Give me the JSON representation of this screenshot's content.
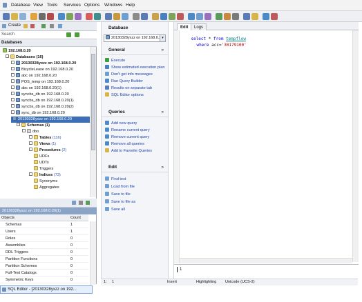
{
  "menu": [
    "Database",
    "View",
    "Tools",
    "Services",
    "Options",
    "Windows",
    "Help"
  ],
  "left": {
    "new_button_label": "Create",
    "search_label": "Search",
    "databases_header": "Databases",
    "server_name": "192.168.0.20",
    "databases_node": "Databases (16)",
    "databases_tree": [
      {
        "label": "20130328yxzz on 192.168.0.20",
        "bold": true
      },
      {
        "label": "BicycleLease on 192.168.0.20"
      },
      {
        "label": "abc on 192.168.0.20"
      },
      {
        "label": "POS_temp on 192.168.0.20"
      },
      {
        "label": "abc on 192.168.0.20(1)"
      },
      {
        "label": "syncbs_db on 192.168.0.20"
      },
      {
        "label": "syncbs_db on 192.168.0.20(1)"
      },
      {
        "label": "syncbs_db on 192.168.0.20(2)"
      },
      {
        "label": "sync_db on 192.168.0.20"
      }
    ],
    "selected_db": "20130328yxzz on 192.168.0.20",
    "schemas_node": "Schemas (1)",
    "dbo_node": "dbo",
    "schema_children": [
      {
        "label": "Tables",
        "count": "(116)"
      },
      {
        "label": "Views",
        "count": "(1)"
      },
      {
        "label": "Procedures",
        "count": "(2)"
      },
      {
        "label": "UDFs",
        "count": ""
      },
      {
        "label": "UDTs",
        "count": ""
      },
      {
        "label": "Triggers",
        "count": ""
      },
      {
        "label": "Indices",
        "count": "(73)"
      },
      {
        "label": "Synonyms",
        "count": ""
      },
      {
        "label": "Aggregates",
        "count": ""
      }
    ],
    "objects_header_title": "20130328yxzz on 192.168.0.20(1)",
    "objects_col_name": "Objects",
    "objects_col_count": "Count",
    "objects": [
      {
        "name": "Schemas",
        "count": "1"
      },
      {
        "name": "Users",
        "count": "1"
      },
      {
        "name": "Roles",
        "count": "0"
      },
      {
        "name": "Assemblies",
        "count": "0"
      },
      {
        "name": "DDL Triggers",
        "count": "0"
      },
      {
        "name": "Partition Functions",
        "count": "0"
      },
      {
        "name": "Partition Schemes",
        "count": "0"
      },
      {
        "name": "Full-Text Catalogs",
        "count": "0"
      },
      {
        "name": "Symmetric Keys",
        "count": "0"
      }
    ]
  },
  "middle": {
    "database_label": "Database",
    "database_value": "20130328yxzz on 192.168.0.20",
    "sections": {
      "general": {
        "title": "General",
        "items": [
          "Execute",
          "Show estimated execution plan",
          "Don't get info messages",
          "Run Query Builder",
          "Results on separate tab",
          "SQL Editor options"
        ]
      },
      "queries": {
        "title": "Queries",
        "items": [
          "Add new query",
          "Rename current query",
          "Remove current query",
          "Remove all queries",
          "Add to Favorite Queries"
        ]
      },
      "edit": {
        "title": "Edit",
        "items": [
          "Find text",
          "Load from file",
          "Save to file",
          "Save to file as",
          "Save all"
        ]
      }
    }
  },
  "editor": {
    "tabs": [
      "Edit",
      "Logs"
    ],
    "line1": {
      "kw1": "select",
      "mid": " * ",
      "kw2": "from",
      "table": "tempflow"
    },
    "line2": {
      "kw": "where",
      "text": " acc=",
      "str": "'30179100'"
    },
    "result_line": "1"
  },
  "status": {
    "pos1": "1:",
    "pos2": "1",
    "mode": "Insert",
    "highlighting": "Highlighting",
    "encoding": "Unicode (UCS-2)"
  },
  "taskbar": {
    "item": "SQL Editor - [20130328yxzz on 192..."
  }
}
